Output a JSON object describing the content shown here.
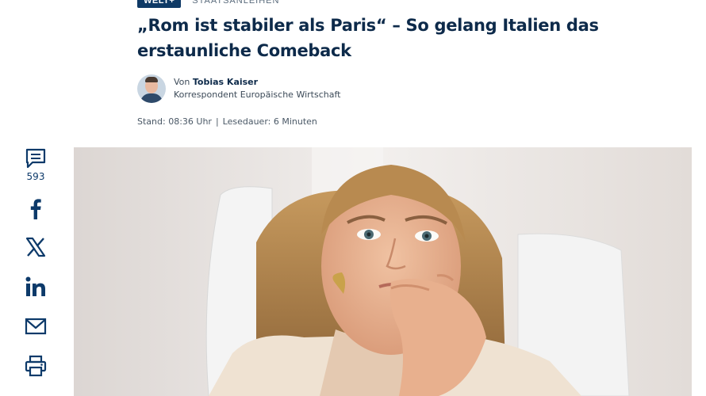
{
  "article": {
    "kicker_badge": "WELT+",
    "kicker_label": "STAATSANLEIHEN",
    "headline": "„Rom ist stabiler als Paris“ – So gelang Italien das erstaunliche Comeback",
    "author_prefix": "Von",
    "author_name": "Tobias Kaiser",
    "author_role": "Korrespondent Europäische Wirtschaft",
    "stand_label": "Stand: 08:36 Uhr",
    "separator": "|",
    "reading_time": "Lesedauer: 6 Minuten"
  },
  "share": {
    "comments_count": "593",
    "items": [
      "comment-icon",
      "facebook-icon",
      "x-icon",
      "linkedin-icon",
      "mail-icon",
      "print-icon"
    ]
  },
  "colors": {
    "brand_navy": "#0d2a4a",
    "icon_blue": "#0d3a6a",
    "badge": "#0f3a66"
  }
}
